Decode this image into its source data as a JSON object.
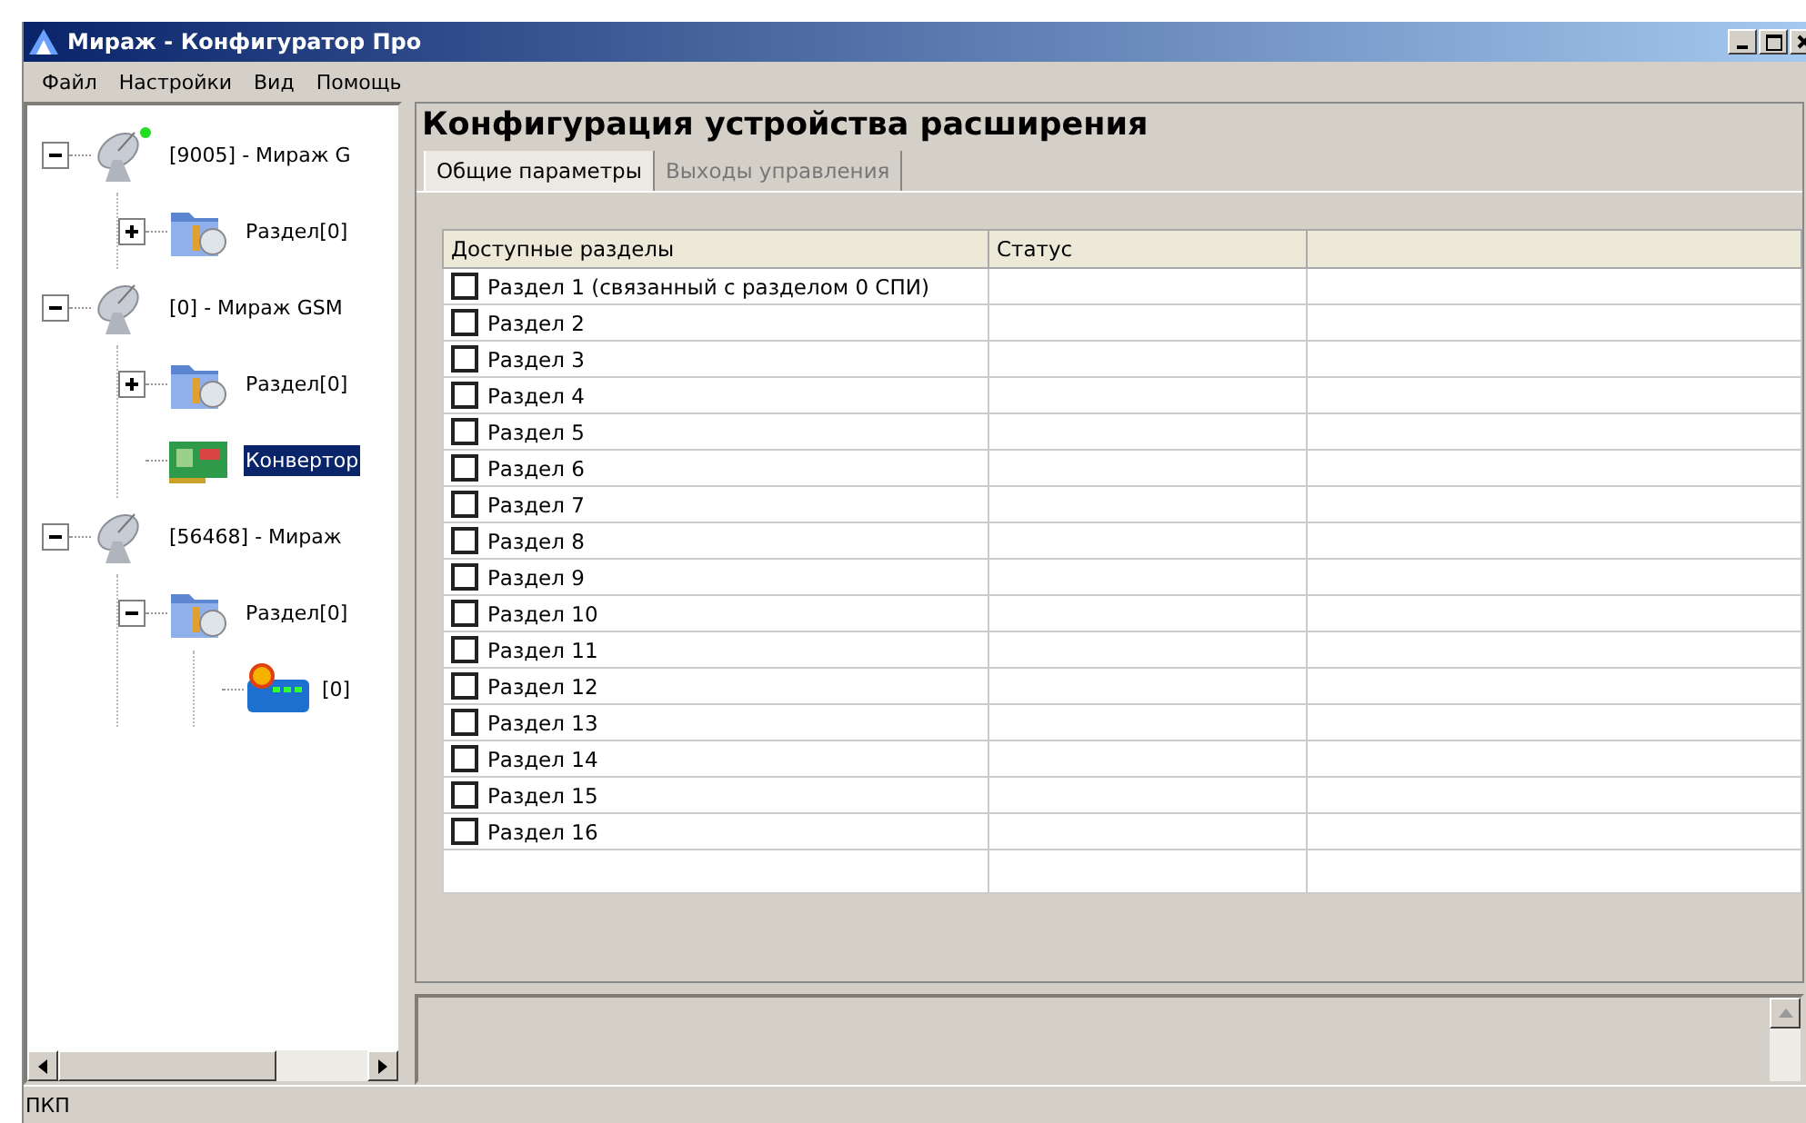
{
  "window": {
    "title": "Мираж - Конфигуратор Про"
  },
  "menu": [
    "Файл",
    "Настройки",
    "Вид",
    "Помощь"
  ],
  "tree": [
    {
      "label": "[9005] - Мираж G",
      "kind": "device",
      "online": true,
      "expanded": true,
      "selected": false,
      "children": [
        {
          "label": "Раздел[0]",
          "kind": "partition",
          "expanded": false,
          "selected": false
        }
      ]
    },
    {
      "label": "[0] - Мираж GSM",
      "kind": "device",
      "online": false,
      "expanded": true,
      "selected": false,
      "children": [
        {
          "label": "Раздел[0]",
          "kind": "partition",
          "expanded": false,
          "selected": false
        },
        {
          "label": "Конвертор",
          "kind": "converter",
          "selected": true
        }
      ]
    },
    {
      "label": "[56468] - Мираж",
      "kind": "device",
      "online": false,
      "expanded": true,
      "selected": false,
      "children": [
        {
          "label": "Раздел[0]",
          "kind": "partition",
          "expanded": true,
          "selected": false,
          "children": [
            {
              "label": "[0]",
              "kind": "module",
              "selected": false
            }
          ]
        }
      ]
    }
  ],
  "panel": {
    "heading": "Конфигурация устройства расширения",
    "tabs": [
      {
        "label": "Общие параметры",
        "selected": true
      },
      {
        "label": "Выходы управления",
        "selected": false
      }
    ],
    "table": {
      "columns": [
        "Доступные разделы",
        "Статус"
      ],
      "rows": [
        {
          "name": "Раздел 1 (связанный с разделом 0 СПИ)",
          "checked": false
        },
        {
          "name": "Раздел 2",
          "checked": false
        },
        {
          "name": "Раздел 3",
          "checked": false
        },
        {
          "name": "Раздел 4",
          "checked": false
        },
        {
          "name": "Раздел 5",
          "checked": false
        },
        {
          "name": "Раздел 6",
          "checked": false
        },
        {
          "name": "Раздел 7",
          "checked": false
        },
        {
          "name": "Раздел 8",
          "checked": false
        },
        {
          "name": "Раздел 9",
          "checked": false
        },
        {
          "name": "Раздел 10",
          "checked": false
        },
        {
          "name": "Раздел 11",
          "checked": false
        },
        {
          "name": "Раздел 12",
          "checked": false
        },
        {
          "name": "Раздел 13",
          "checked": false
        },
        {
          "name": "Раздел 14",
          "checked": false
        },
        {
          "name": "Раздел 15",
          "checked": false
        },
        {
          "name": "Раздел 16",
          "checked": false
        }
      ]
    }
  },
  "status_bar": "ПКП"
}
